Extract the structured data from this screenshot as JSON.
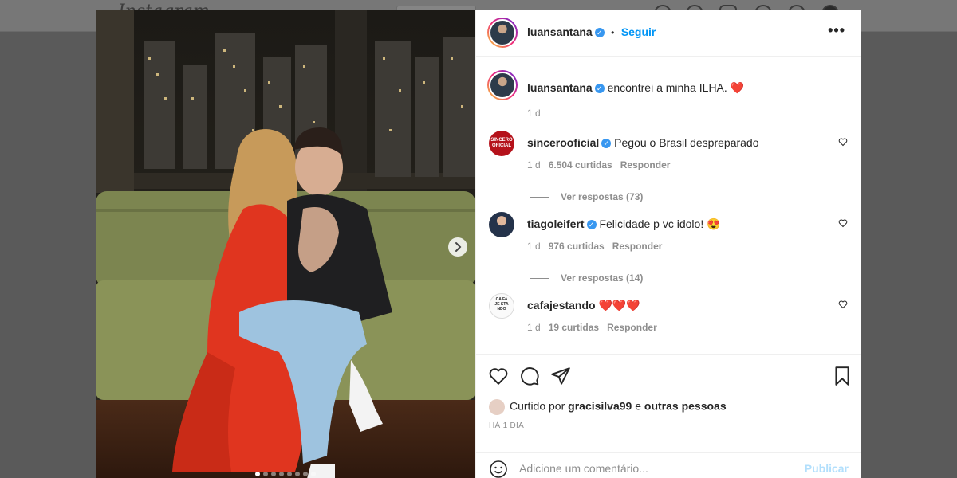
{
  "app": {
    "logo_text": "Instagram"
  },
  "post": {
    "username": "luansantana",
    "follow_label": "Seguir",
    "caption_username": "luansantana",
    "caption_text": "encontrei a minha ILHA. ❤️",
    "caption_age": "1 d",
    "slide_count": 8,
    "current_slide": 1
  },
  "comments": [
    {
      "username": "sincerooficial",
      "text": "Pegou o Brasil despreparado",
      "age": "1 d",
      "likes": "6.504 curtidas",
      "reply_label": "Responder",
      "replies": "Ver respostas (73)",
      "avatar_text": "SINCERO OFICIAL",
      "verified": true
    },
    {
      "username": "tiagoleifert",
      "text": "Felicidade p vc idolo! 😍",
      "age": "1 d",
      "likes": "976 curtidas",
      "reply_label": "Responder",
      "replies": "Ver respostas (14)",
      "verified": true
    },
    {
      "username": "cafajestando",
      "text": "❤️❤️❤️",
      "age": "1 d",
      "likes": "19 curtidas",
      "reply_label": "Responder",
      "avatar_text": "CA FA JE STA NDO",
      "verified": false
    }
  ],
  "likes": {
    "prefix": "Curtido por",
    "user": "gracisilva99",
    "joiner": "e",
    "others": "outras pessoas"
  },
  "timestamp": "HÁ 1 DIA",
  "comment_box": {
    "placeholder": "Adicione um comentário...",
    "publish_label": "Publicar"
  },
  "icons": [
    "heart-icon",
    "comment-icon",
    "share-icon",
    "bookmark-icon",
    "emoji-icon",
    "more-icon",
    "verified-icon",
    "chevron-right-icon"
  ],
  "colors": {
    "accent": "#0095f6",
    "verified": "#3897f0",
    "publish_disabled": "#b2dffc",
    "muted": "#8e8e8e"
  }
}
